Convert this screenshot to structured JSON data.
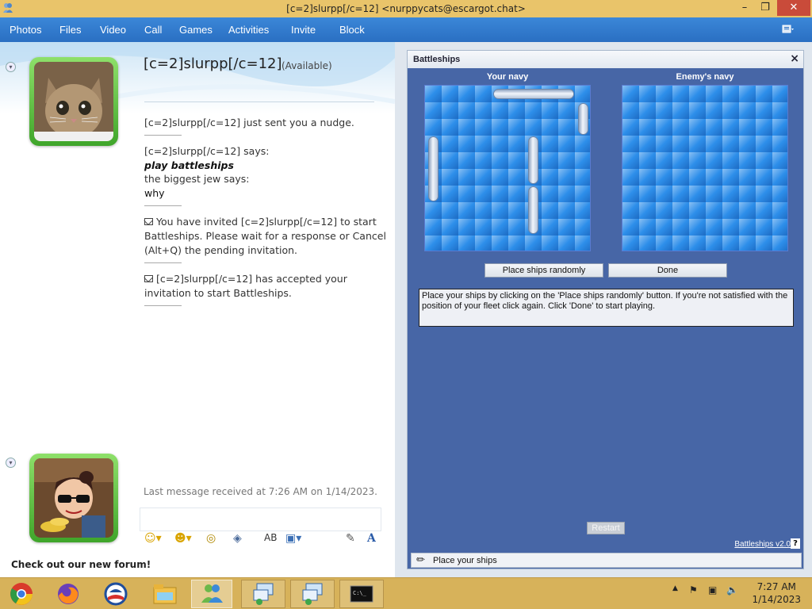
{
  "window": {
    "title": "[c=2]slurpp[/c=12] <nurppycats@escargot.chat>",
    "minimize": "–",
    "maximize": "❐",
    "close": "✕"
  },
  "menu": {
    "items": [
      "Photos",
      "Files",
      "Video",
      "Call",
      "Games",
      "Activities",
      "Invite",
      "Block"
    ]
  },
  "contact": {
    "name": "[c=2]slurpp[/c=12]",
    "status": "(Available)"
  },
  "conversation": {
    "nudge": "[c=2]slurpp[/c=12] just sent you a nudge.",
    "says1": "[c=2]slurpp[/c=12] says:",
    "msg1": "play battleships",
    "says2": "the biggest jew says:",
    "msg2": "why",
    "invite": "You have invited [c=2]slurpp[/c=12] to start Battleships. Please wait for a response or Cancel (Alt+Q) the pending invitation.",
    "accepted": "[c=2]slurpp[/c=12] has accepted your invitation to start Battleships."
  },
  "last_message": "Last message received at 7:26 AM on 1/14/2023.",
  "forum_text": "Check out our new forum!",
  "game": {
    "title": "Battleships",
    "close": "×",
    "your_navy": "Your navy",
    "enemy_navy": "Enemy's navy",
    "place_randomly": "Place ships randomly",
    "done": "Done",
    "info": "Place your ships by clicking on the 'Place ships randomly' button. If you're not satisfied with the position of your fleet click again. Click 'Done' to start playing.",
    "restart": "Restart",
    "version": "Battleships v2.0",
    "help": "?",
    "status": "Place your ships"
  },
  "clock": {
    "time": "7:27 AM",
    "date": "1/14/2023"
  },
  "colors": {
    "titlebar": "#e9c46a",
    "menubar": "#2a6fc2",
    "game_bg": "#4766a6",
    "board": "#2d8eea",
    "taskbar": "#d7b25a"
  }
}
